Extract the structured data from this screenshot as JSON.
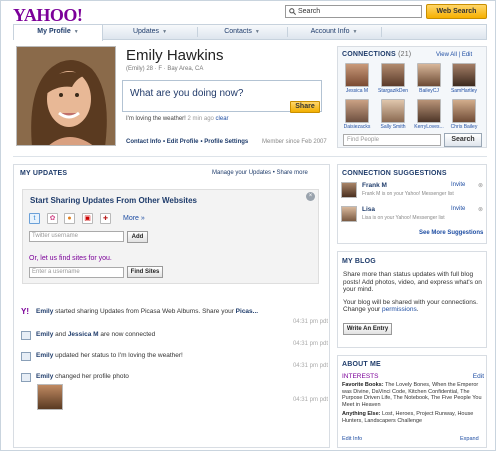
{
  "header": {
    "logo": "YAHOO!",
    "search_placeholder": "Search",
    "web_search": "Web Search"
  },
  "nav": {
    "tabs": [
      "My Profile",
      "Updates",
      "Contacts",
      "Account Info"
    ]
  },
  "profile": {
    "name": "Emily Hawkins",
    "meta": "(Emily) 28 · F · Bay Area, CA",
    "status_prompt": "What are you doing now?",
    "share": "Share",
    "status_text": "I'm loving the weather!",
    "status_time": "2 min ago",
    "clear": "clear",
    "links": [
      "Contact Info",
      "Edit Profile",
      "Profile Settings"
    ],
    "member_since": "Member since Feb 2007"
  },
  "connections": {
    "title": "CONNECTIONS",
    "count": "(21)",
    "view_all": "View All",
    "edit": "Edit",
    "people": [
      "Jessica M",
      "StargazikDen",
      "BaileyCJ",
      "SamHartley",
      "Daisiezacks",
      "Sally Smith",
      "KerryLoves...",
      "Chris Bailey"
    ],
    "find_placeholder": "Find People",
    "search": "Search"
  },
  "updates": {
    "title": "MY UPDATES",
    "manage": "Manage your Updates",
    "more": "Share more",
    "share_title": "Start Sharing Updates From Other Websites",
    "more_link": "More »",
    "twitter_placeholder": "Twitter username",
    "add": "Add",
    "or_text": "Or, let us find sites for you.",
    "user_placeholder": "Enter a username",
    "find_sites": "Find Sites",
    "feed": [
      {
        "who": "Emily",
        "text": " started sharing Updates from Picasa Web Albums. Share your ",
        "tail": "Picas...",
        "time": "04:31 pm pdt"
      },
      {
        "who": "Emily",
        "text": " and ",
        "who2": "Jessica M",
        "text2": " are now connected",
        "time": "04:31 pm pdt"
      },
      {
        "who": "Emily",
        "text": " updated her status to I'm loving the weather!",
        "time": "04:31 pm pdt"
      },
      {
        "who": "Emily",
        "text": " changed her profile photo",
        "time": "04:31 pm pdt"
      }
    ]
  },
  "suggestions": {
    "title": "CONNECTION SUGGESTIONS",
    "items": [
      {
        "name": "Frank M",
        "sub": "Frank M is on your Yahoo! Messenger list",
        "invite": "Invite"
      },
      {
        "name": "Lisa",
        "sub": "Lisa is on your Yahoo! Messenger list",
        "invite": "Invite"
      }
    ],
    "see_more": "See More Suggestions"
  },
  "blog": {
    "title": "MY BLOG",
    "p1": "Share more than status updates with full blog posts! Add photos, video, and express what's on your mind.",
    "p2a": "Your blog will be shared with your connections. Change your ",
    "p2link": "permissions",
    "p2b": ".",
    "button": "Write An Entry"
  },
  "about": {
    "title": "ABOUT ME",
    "interests": "INTERESTS",
    "edit": "Edit",
    "books_label": "Favorite Books:",
    "books": " The Lovely Bones, When the Emperor was Divine, DaVinci Code, Kitchen Confidential, The Purpose Driven Life, The Notebook, The Five People You Meet in Heaven",
    "else_label": "Anything Else:",
    "else": " Lost, Heroes, Project Runway, House Hunters, Landscapers Challenge",
    "edit_info": "Edit Info",
    "expand": "Expand"
  }
}
